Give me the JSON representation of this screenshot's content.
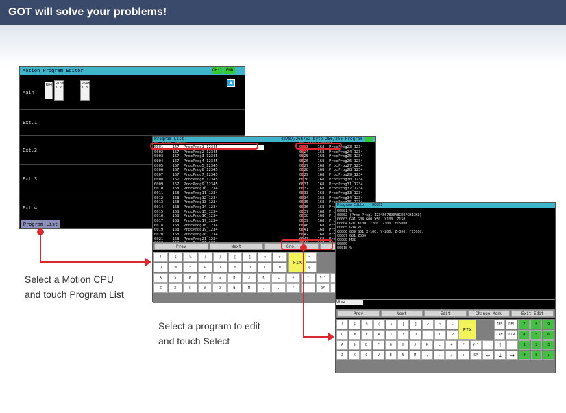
{
  "header": {
    "title": "GOT will solve your problems!"
  },
  "screen1": {
    "title": "Motion Program Editor",
    "ch_button": "CH:1",
    "end_button": "END",
    "rows": [
      "Main",
      "Ext.1",
      "Ext.2",
      "Ext.3",
      "Ext.4"
    ],
    "modules": [
      "R04",
      "R16M T 2",
      "R64M T 3"
    ],
    "footer_button": "Program List"
  },
  "screen2": {
    "title": "Program List",
    "info": "42787/266752 byte   256/256 Program",
    "head_left": "No.   Size   Comment",
    "head_right": "No.   Size   Comment",
    "left_rows": [
      "0001    167  ProcProg1_12345",
      "0002    167  ProcProg2_12345",
      "0003    167  ProcProg3_12345",
      "0004    167  ProcProg4_12345",
      "0005    167  ProcProg5_12345",
      "0006    167  ProcProg6_12345",
      "0007    167  ProcProg7_12345",
      "0008    167  ProcProg8_12345",
      "0009    167  ProcProg9_12345",
      "0010    168  ProcProg10_1234",
      "0011    168  ProcProg11_1234",
      "0012    168  ProcProg12_1234",
      "0013    168  ProcProg13_1234",
      "0014    168  ProcProg14_1234",
      "0015    168  ProcProg15_1234",
      "0016    168  ProcProg16_1234",
      "0017    168  ProcProg17_1234",
      "0018    168  ProcProg18_1234",
      "0019    168  ProcProg19_1234",
      "0020    168  ProcProg20_1234",
      "0021    168  ProcProg21_1234",
      "0022    168  ProcProg22_1234"
    ],
    "right_rows": [
      "0023    168  ProcProg23_1234",
      "0024    168  ProcProg24_1234",
      "0025    168  ProcProg25_1234",
      "0026    168  ProcProg26_1234",
      "0027    168  ProcProg27_1234",
      "0028    168  ProcProg28_1234",
      "0029    168  ProcProg29_1234",
      "0030    168  ProcProg30_1234",
      "0031    168  ProcProg31_1234",
      "0032    168  ProcProg32_1234",
      "0033    168  ProcProg33_1234",
      "0034    168  ProcProg34_1234",
      "0035    168  ProcProg35_1234",
      "0036    168  ProcProg36_1234",
      "0037    168  ProcProg37_1234",
      "0038    168  ProcProg38_1234",
      "0039    168  ProcProg39_1234",
      "0040    168  ProcProg40_1234",
      "0041    168  ProcProg41_1234",
      "0042    168  ProcProg42_1234",
      "0043    168  ProcProg43_1234",
      "0044    168  ProcProg44_1234"
    ],
    "buttons": [
      "Prev",
      "Next",
      "Ono.",
      "Select"
    ]
  },
  "keyboard": {
    "row1": [
      "!",
      "$",
      "%",
      "(",
      ")",
      "[",
      "]",
      "<",
      ">",
      "-",
      "="
    ],
    "row2": [
      "Q",
      "W",
      "E",
      "R",
      "T",
      "Y",
      "U",
      "I",
      "O",
      "P",
      "@"
    ],
    "row3": [
      "A",
      "S",
      "D",
      "F",
      "G",
      "H",
      "J",
      "K",
      "L",
      "+",
      "*",
      "¥-\\"
    ],
    "row4": [
      "Z",
      "X",
      "C",
      "V",
      "B",
      "N",
      "M",
      ",",
      ".",
      "/",
      ":",
      "SP"
    ],
    "fix": "FIX",
    "ins": "INS",
    "del": "DEL",
    "can": "CAN",
    "clr": "CLR",
    "numpad": [
      "7",
      "8",
      "9",
      "4",
      "5",
      "6",
      "1",
      "2",
      "3",
      "#",
      "0",
      ";"
    ]
  },
  "screen3": {
    "title": "Program Editor : 00001",
    "lines": [
      "00001 %",
      "00002 (Proc Prog1_1234567890ABCDEFGHIJKL)",
      "00003 G91 G04 G00 X50. Y100. Z150.",
      "00004 G01 X100. Y200. Z300. F15000.",
      "00005 G04 P1",
      "00006 G09 G01 X-100. Y-200. Z-300. F15000.",
      "00007 G01 Z500.",
      "00008 M02",
      "00009",
      "00010 %"
    ],
    "cmd": "View",
    "buttons": [
      "Prev",
      "Next",
      "Edit",
      "Change Menu",
      "Exit Edit"
    ]
  },
  "annotations": {
    "callout1_line1": "Select a Motion CPU",
    "callout1_line2": "and touch Program List",
    "callout2_line1": "Select a program to edit",
    "callout2_line2": "and touch Select"
  }
}
